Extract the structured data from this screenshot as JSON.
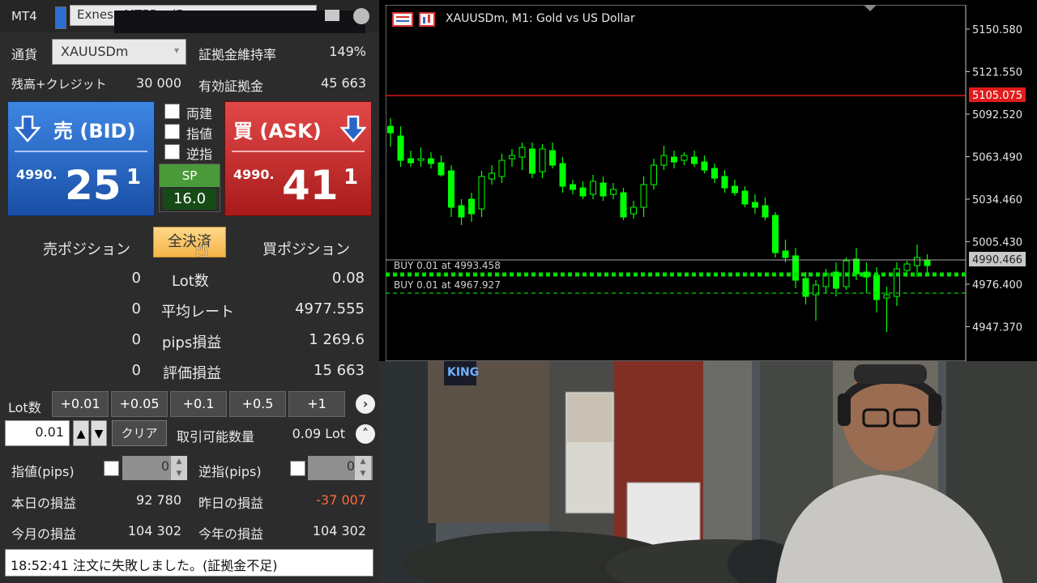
{
  "app": {
    "name": "MT4",
    "account": "Exness-MT5Real5"
  },
  "panel": {
    "currency_label": "通貨",
    "symbol": "XAUUSDm",
    "margin_level_label": "証拠金維持率",
    "margin_level": "149%",
    "balance_label": "残高+クレジット",
    "balance": "30 000",
    "equity_label": "有効証拠金",
    "equity": "45 663",
    "bid": {
      "title": "売 (BID)",
      "prefix": "4990.",
      "big": "25",
      "sup": "1"
    },
    "ask": {
      "title": "買 (ASK)",
      "prefix": "4990.",
      "big": "41",
      "sup": "1"
    },
    "options": {
      "hedge": "両建",
      "limit": "指値",
      "stop": "逆指"
    },
    "spread": {
      "label": "SP",
      "value": "16.0"
    },
    "close_all": "全決済",
    "sell_pos_label": "売ポジション",
    "buy_pos_label": "買ポジション",
    "stats": [
      {
        "sell": "0",
        "label": "Lot数",
        "buy": "0.08"
      },
      {
        "sell": "0",
        "label": "平均レート",
        "buy": "4977.555"
      },
      {
        "sell": "0",
        "label": "pips損益",
        "buy": "1 269.6"
      },
      {
        "sell": "0",
        "label": "評価損益",
        "buy": "15 663"
      }
    ],
    "lot_label": "Lot数",
    "lot_buttons": [
      "+0.01",
      "+0.05",
      "+0.1",
      "+0.5",
      "+1"
    ],
    "lot_value": "0.01",
    "clear_label": "クリア",
    "tradable_label": "取引可能数量",
    "tradable_value": "0.09 Lot",
    "limit_pips_label": "指値(pips)",
    "limit_pips_value": "0",
    "stop_pips_label": "逆指(pips)",
    "stop_pips_value": "0",
    "today_pl_label": "本日の損益",
    "today_pl": "92 780",
    "yesterday_pl_label": "昨日の損益",
    "yesterday_pl": "-37 007",
    "month_pl_label": "今月の損益",
    "month_pl": "104 302",
    "year_pl_label": "今年の損益",
    "year_pl": "104 302",
    "status_message": "18:52:41 注文に失敗しました。(証拠金不足)"
  },
  "chart": {
    "title": "XAUUSDm, M1:  Gold vs US Dollar",
    "price_labels": [
      "5150.580",
      "5121.550",
      "5092.520",
      "5063.490",
      "5034.460",
      "5005.430",
      "4976.400",
      "4947.370"
    ],
    "current_price": "4990.466",
    "red_line_price": "5105.075",
    "orders": [
      "BUY 0.01 at 4993.458",
      "BUY 0.01 at 4967.927"
    ],
    "colors": {
      "bull": "#00ff00",
      "bear": "#000000",
      "line_red": "#ff2020"
    }
  },
  "colors": {
    "bid": "#2a64c8",
    "ask": "#d23030",
    "loss": "#ff6a3d",
    "close_all": "#f4c062"
  },
  "webcam": {
    "sign_text": "KING"
  }
}
